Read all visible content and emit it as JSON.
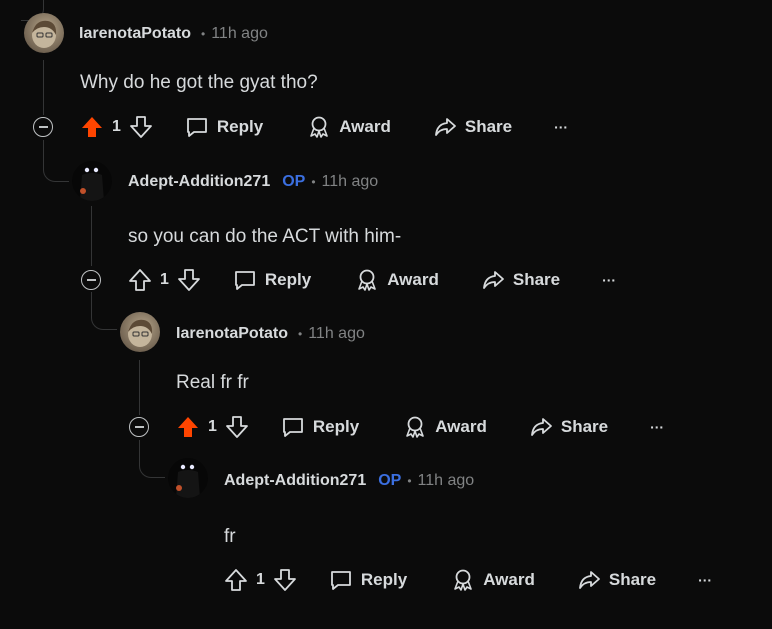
{
  "comments": [
    {
      "username": "IarenotaPotato",
      "op_label": "",
      "dot": "•",
      "time": "11h ago",
      "text": "Why do he got the gyat tho?",
      "votes": "1",
      "upvoted": true,
      "reply_label": "Reply",
      "award_label": "Award",
      "share_label": "Share",
      "more_label": "···"
    },
    {
      "username": "Adept-Addition271",
      "op_label": "OP",
      "dot": "•",
      "time": "11h ago",
      "text": "so you can do the ACT with him-",
      "votes": "1",
      "upvoted": false,
      "reply_label": "Reply",
      "award_label": "Award",
      "share_label": "Share",
      "more_label": "···"
    },
    {
      "username": "IarenotaPotato",
      "op_label": "",
      "dot": "•",
      "time": "11h ago",
      "text": "Real fr fr",
      "votes": "1",
      "upvoted": true,
      "reply_label": "Reply",
      "award_label": "Award",
      "share_label": "Share",
      "more_label": "···"
    },
    {
      "username": "Adept-Addition271",
      "op_label": "OP",
      "dot": "•",
      "time": "11h ago",
      "text": "fr",
      "votes": "1",
      "upvoted": false,
      "reply_label": "Reply",
      "award_label": "Award",
      "share_label": "Share",
      "more_label": "···"
    }
  ],
  "colors": {
    "background": "#0b0b0b",
    "text": "#d7dadc",
    "muted": "#818384",
    "op": "#3b6fe0",
    "upvote_active": "#ff4500"
  }
}
